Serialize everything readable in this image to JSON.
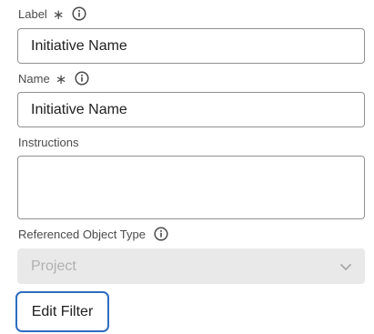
{
  "form": {
    "label_field": {
      "label": "Label",
      "required_mark": "∗",
      "value": "Initiative Name"
    },
    "name_field": {
      "label": "Name",
      "required_mark": "∗",
      "value": "Initiative Name"
    },
    "instructions_field": {
      "label": "Instructions",
      "value": ""
    },
    "referenced_object_type": {
      "label": "Referenced Object Type",
      "selected": "Project",
      "disabled": true
    },
    "edit_filter_button": {
      "label": "Edit Filter"
    }
  },
  "icons": {
    "info": "info-icon",
    "dropdown": "chevron-down-icon"
  },
  "colors": {
    "focus_ring": "#2f6dbf",
    "input_border": "#909090",
    "disabled_bg": "#e9e9e9",
    "disabled_text": "#b0b0b0"
  }
}
